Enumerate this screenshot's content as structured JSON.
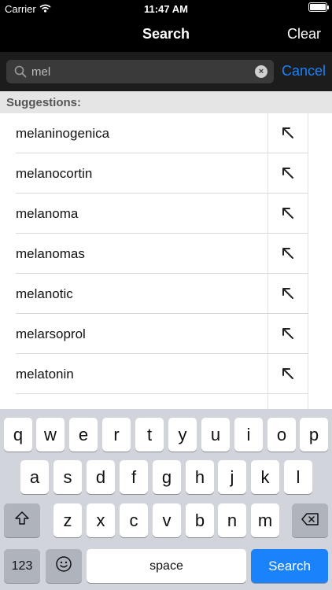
{
  "status": {
    "carrier": "Carrier",
    "time": "11:47 AM"
  },
  "nav": {
    "title": "Search",
    "clear_label": "Clear"
  },
  "search": {
    "value": "mel",
    "cancel_label": "Cancel"
  },
  "suggestions": {
    "header": "Suggestions:",
    "items": [
      {
        "label": "melaninogenica"
      },
      {
        "label": "melanocortin"
      },
      {
        "label": "melanoma"
      },
      {
        "label": "melanomas"
      },
      {
        "label": "melanotic"
      },
      {
        "label": "melarsoprol"
      },
      {
        "label": "melatonin"
      }
    ]
  },
  "keyboard": {
    "row1": [
      "q",
      "w",
      "e",
      "r",
      "t",
      "y",
      "u",
      "i",
      "o",
      "p"
    ],
    "row2": [
      "a",
      "s",
      "d",
      "f",
      "g",
      "h",
      "j",
      "k",
      "l"
    ],
    "row3": [
      "z",
      "x",
      "c",
      "v",
      "b",
      "n",
      "m"
    ],
    "numbers_label": "123",
    "space_label": "space",
    "search_label": "Search"
  },
  "colors": {
    "accent": "#1a82fb",
    "bar_background": "#000000",
    "keyboard_background": "#d1d4da"
  }
}
